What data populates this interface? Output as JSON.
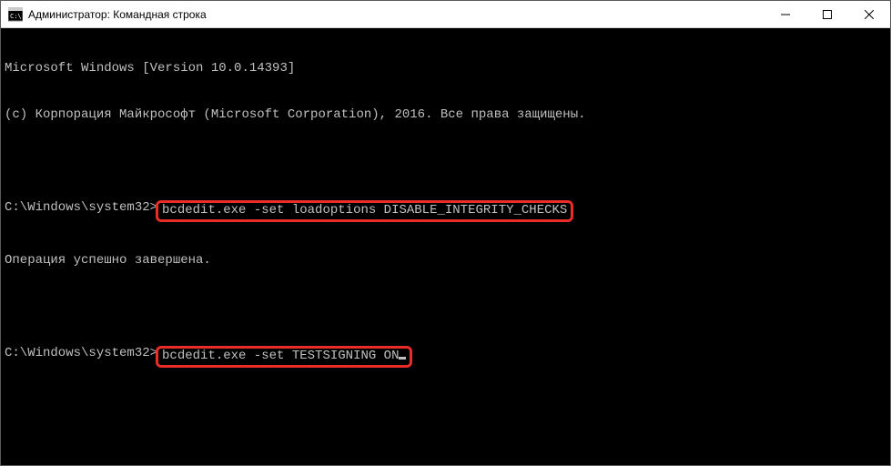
{
  "window": {
    "title": "Администратор: Командная строка"
  },
  "console": {
    "header_line1": "Microsoft Windows [Version 10.0.14393]",
    "header_line2": "(c) Корпорация Майкрософт (Microsoft Corporation), 2016. Все права защищены.",
    "prompt": "C:\\Windows\\system32>",
    "cmd1": "bcdedit.exe -set loadoptions DISABLE_INTEGRITY_CHECKS",
    "result1": "Операция успешно завершена.",
    "cmd2": "bcdedit.exe -set TESTSIGNING ON"
  }
}
